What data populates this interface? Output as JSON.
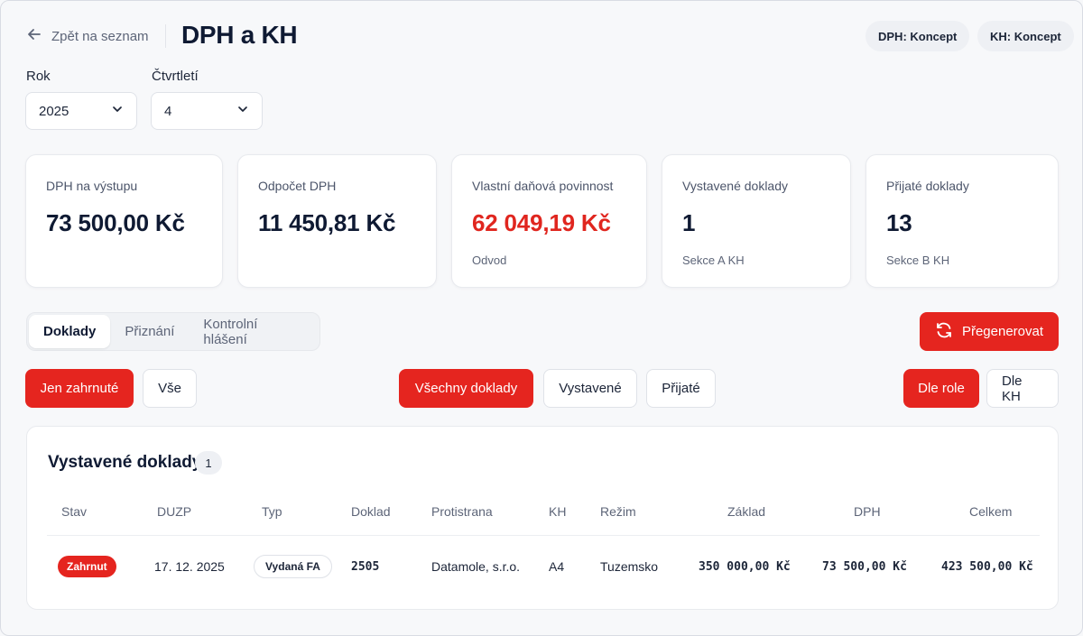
{
  "header": {
    "back_label": "Zpět na seznam",
    "title": "DPH a KH",
    "status_dph": "DPH: Koncept",
    "status_kh": "KH: Koncept"
  },
  "filters": {
    "year_label": "Rok",
    "year_value": "2025",
    "quarter_label": "Čtvrtletí",
    "quarter_value": "4"
  },
  "cards": [
    {
      "label": "DPH na výstupu",
      "value": "73 500,00 Kč",
      "sub": ""
    },
    {
      "label": "Odpočet DPH",
      "value": "11 450,81 Kč",
      "sub": ""
    },
    {
      "label": "Vlastní daňová povinnost",
      "value": "62 049,19 Kč",
      "sub": "Odvod"
    },
    {
      "label": "Vystavené doklady",
      "value": "1",
      "sub": "Sekce A KH"
    },
    {
      "label": "Přijaté doklady",
      "value": "13",
      "sub": "Sekce B KH"
    }
  ],
  "tabs": [
    "Doklady",
    "Přiznání",
    "Kontrolní hlášení"
  ],
  "regenerate_label": "Přegenerovat",
  "scope_filter": [
    "Jen zahrnuté",
    "Vše"
  ],
  "doc_filter": [
    "Všechny doklady",
    "Vystavené",
    "Přijaté"
  ],
  "group_filter": [
    "Dle role",
    "Dle KH"
  ],
  "table": {
    "title": "Vystavené doklady",
    "count": "1",
    "columns": [
      "Stav",
      "DUZP",
      "Typ",
      "Doklad",
      "Protistrana",
      "KH",
      "Režim",
      "Základ",
      "DPH",
      "Celkem"
    ],
    "rows": [
      {
        "stav": "Zahrnut",
        "duzp": "17. 12. 2025",
        "typ": "Vydaná FA",
        "doklad": "2505",
        "protistrana": "Datamole, s.r.o.",
        "kh": "A4",
        "rezim": "Tuzemsko",
        "zaklad": "350 000,00 Kč",
        "dph": "73 500,00 Kč",
        "celkem": "423 500,00 Kč"
      }
    ]
  },
  "colors": {
    "accent_red": "#e5251f",
    "text_dark": "#0f1a33",
    "text_muted": "#5d6578"
  }
}
